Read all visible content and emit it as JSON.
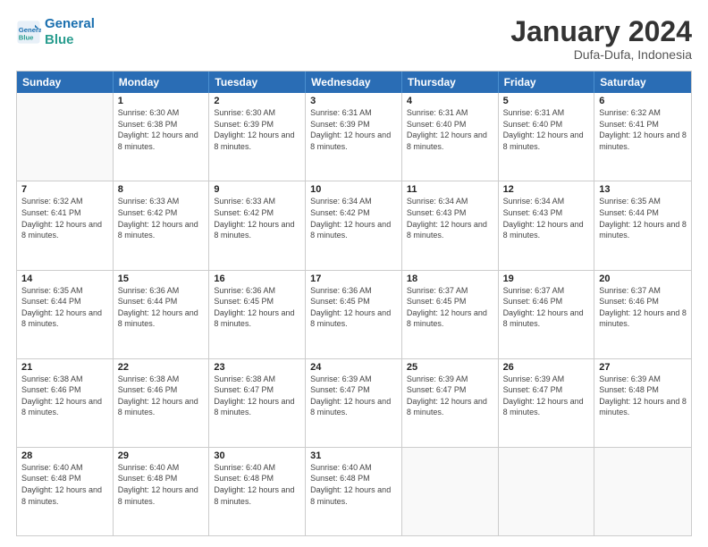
{
  "header": {
    "logo_line1": "General",
    "logo_line2": "Blue",
    "title": "January 2024",
    "subtitle": "Dufa-Dufa, Indonesia"
  },
  "days_of_week": [
    "Sunday",
    "Monday",
    "Tuesday",
    "Wednesday",
    "Thursday",
    "Friday",
    "Saturday"
  ],
  "weeks": [
    [
      {
        "day": "",
        "sunrise": "",
        "sunset": "",
        "daylight": ""
      },
      {
        "day": "1",
        "sunrise": "6:30 AM",
        "sunset": "6:38 PM",
        "daylight": "12 hours and 8 minutes."
      },
      {
        "day": "2",
        "sunrise": "6:30 AM",
        "sunset": "6:39 PM",
        "daylight": "12 hours and 8 minutes."
      },
      {
        "day": "3",
        "sunrise": "6:31 AM",
        "sunset": "6:39 PM",
        "daylight": "12 hours and 8 minutes."
      },
      {
        "day": "4",
        "sunrise": "6:31 AM",
        "sunset": "6:40 PM",
        "daylight": "12 hours and 8 minutes."
      },
      {
        "day": "5",
        "sunrise": "6:31 AM",
        "sunset": "6:40 PM",
        "daylight": "12 hours and 8 minutes."
      },
      {
        "day": "6",
        "sunrise": "6:32 AM",
        "sunset": "6:41 PM",
        "daylight": "12 hours and 8 minutes."
      }
    ],
    [
      {
        "day": "7",
        "sunrise": "6:32 AM",
        "sunset": "6:41 PM",
        "daylight": "12 hours and 8 minutes."
      },
      {
        "day": "8",
        "sunrise": "6:33 AM",
        "sunset": "6:42 PM",
        "daylight": "12 hours and 8 minutes."
      },
      {
        "day": "9",
        "sunrise": "6:33 AM",
        "sunset": "6:42 PM",
        "daylight": "12 hours and 8 minutes."
      },
      {
        "day": "10",
        "sunrise": "6:34 AM",
        "sunset": "6:42 PM",
        "daylight": "12 hours and 8 minutes."
      },
      {
        "day": "11",
        "sunrise": "6:34 AM",
        "sunset": "6:43 PM",
        "daylight": "12 hours and 8 minutes."
      },
      {
        "day": "12",
        "sunrise": "6:34 AM",
        "sunset": "6:43 PM",
        "daylight": "12 hours and 8 minutes."
      },
      {
        "day": "13",
        "sunrise": "6:35 AM",
        "sunset": "6:44 PM",
        "daylight": "12 hours and 8 minutes."
      }
    ],
    [
      {
        "day": "14",
        "sunrise": "6:35 AM",
        "sunset": "6:44 PM",
        "daylight": "12 hours and 8 minutes."
      },
      {
        "day": "15",
        "sunrise": "6:36 AM",
        "sunset": "6:44 PM",
        "daylight": "12 hours and 8 minutes."
      },
      {
        "day": "16",
        "sunrise": "6:36 AM",
        "sunset": "6:45 PM",
        "daylight": "12 hours and 8 minutes."
      },
      {
        "day": "17",
        "sunrise": "6:36 AM",
        "sunset": "6:45 PM",
        "daylight": "12 hours and 8 minutes."
      },
      {
        "day": "18",
        "sunrise": "6:37 AM",
        "sunset": "6:45 PM",
        "daylight": "12 hours and 8 minutes."
      },
      {
        "day": "19",
        "sunrise": "6:37 AM",
        "sunset": "6:46 PM",
        "daylight": "12 hours and 8 minutes."
      },
      {
        "day": "20",
        "sunrise": "6:37 AM",
        "sunset": "6:46 PM",
        "daylight": "12 hours and 8 minutes."
      }
    ],
    [
      {
        "day": "21",
        "sunrise": "6:38 AM",
        "sunset": "6:46 PM",
        "daylight": "12 hours and 8 minutes."
      },
      {
        "day": "22",
        "sunrise": "6:38 AM",
        "sunset": "6:46 PM",
        "daylight": "12 hours and 8 minutes."
      },
      {
        "day": "23",
        "sunrise": "6:38 AM",
        "sunset": "6:47 PM",
        "daylight": "12 hours and 8 minutes."
      },
      {
        "day": "24",
        "sunrise": "6:39 AM",
        "sunset": "6:47 PM",
        "daylight": "12 hours and 8 minutes."
      },
      {
        "day": "25",
        "sunrise": "6:39 AM",
        "sunset": "6:47 PM",
        "daylight": "12 hours and 8 minutes."
      },
      {
        "day": "26",
        "sunrise": "6:39 AM",
        "sunset": "6:47 PM",
        "daylight": "12 hours and 8 minutes."
      },
      {
        "day": "27",
        "sunrise": "6:39 AM",
        "sunset": "6:48 PM",
        "daylight": "12 hours and 8 minutes."
      }
    ],
    [
      {
        "day": "28",
        "sunrise": "6:40 AM",
        "sunset": "6:48 PM",
        "daylight": "12 hours and 8 minutes."
      },
      {
        "day": "29",
        "sunrise": "6:40 AM",
        "sunset": "6:48 PM",
        "daylight": "12 hours and 8 minutes."
      },
      {
        "day": "30",
        "sunrise": "6:40 AM",
        "sunset": "6:48 PM",
        "daylight": "12 hours and 8 minutes."
      },
      {
        "day": "31",
        "sunrise": "6:40 AM",
        "sunset": "6:48 PM",
        "daylight": "12 hours and 8 minutes."
      },
      {
        "day": "",
        "sunrise": "",
        "sunset": "",
        "daylight": ""
      },
      {
        "day": "",
        "sunrise": "",
        "sunset": "",
        "daylight": ""
      },
      {
        "day": "",
        "sunrise": "",
        "sunset": "",
        "daylight": ""
      }
    ]
  ]
}
